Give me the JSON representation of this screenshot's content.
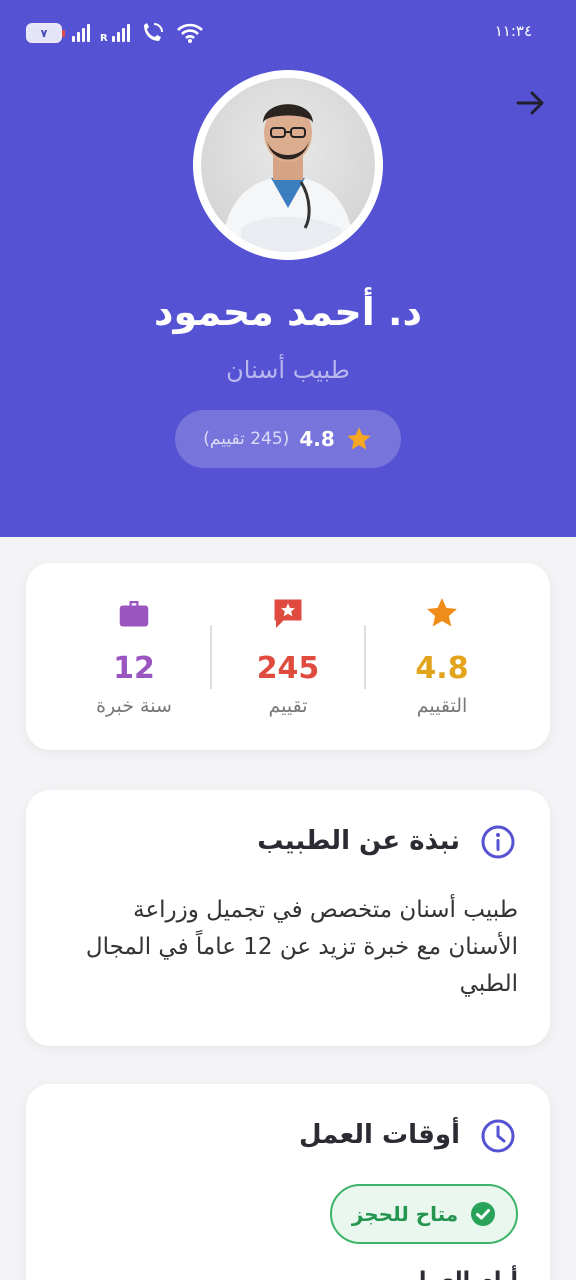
{
  "status_bar": {
    "battery": "٧",
    "time": "١١:٣٤",
    "carrier_r": "R"
  },
  "doctor": {
    "name": "د. أحمد محمود",
    "specialty": "طبيب أسنان",
    "rating": "4.8",
    "reviews_text": "(245 تقييم)"
  },
  "stats": [
    {
      "icon": "star-icon",
      "value": "4.8",
      "label": "التقييم",
      "color": "#e3a31a"
    },
    {
      "icon": "chat-star-icon",
      "value": "245",
      "label": "تقييم",
      "color": "#e04b3f"
    },
    {
      "icon": "briefcase-icon",
      "value": "12",
      "label": "سنة خبرة",
      "color": "#9b55c0"
    }
  ],
  "about": {
    "title": "نبذة عن الطبيب",
    "text": "طبيب أسنان متخصص في تجميل وزراعة الأسنان مع خبرة تزيد عن 12 عاماً في المجال الطبي"
  },
  "hours": {
    "title": "أوقات العمل",
    "availability": "متاح للحجز",
    "next_heading": "أيام العمل"
  },
  "colors": {
    "primary": "#5552d4",
    "available": "#3db36a"
  }
}
